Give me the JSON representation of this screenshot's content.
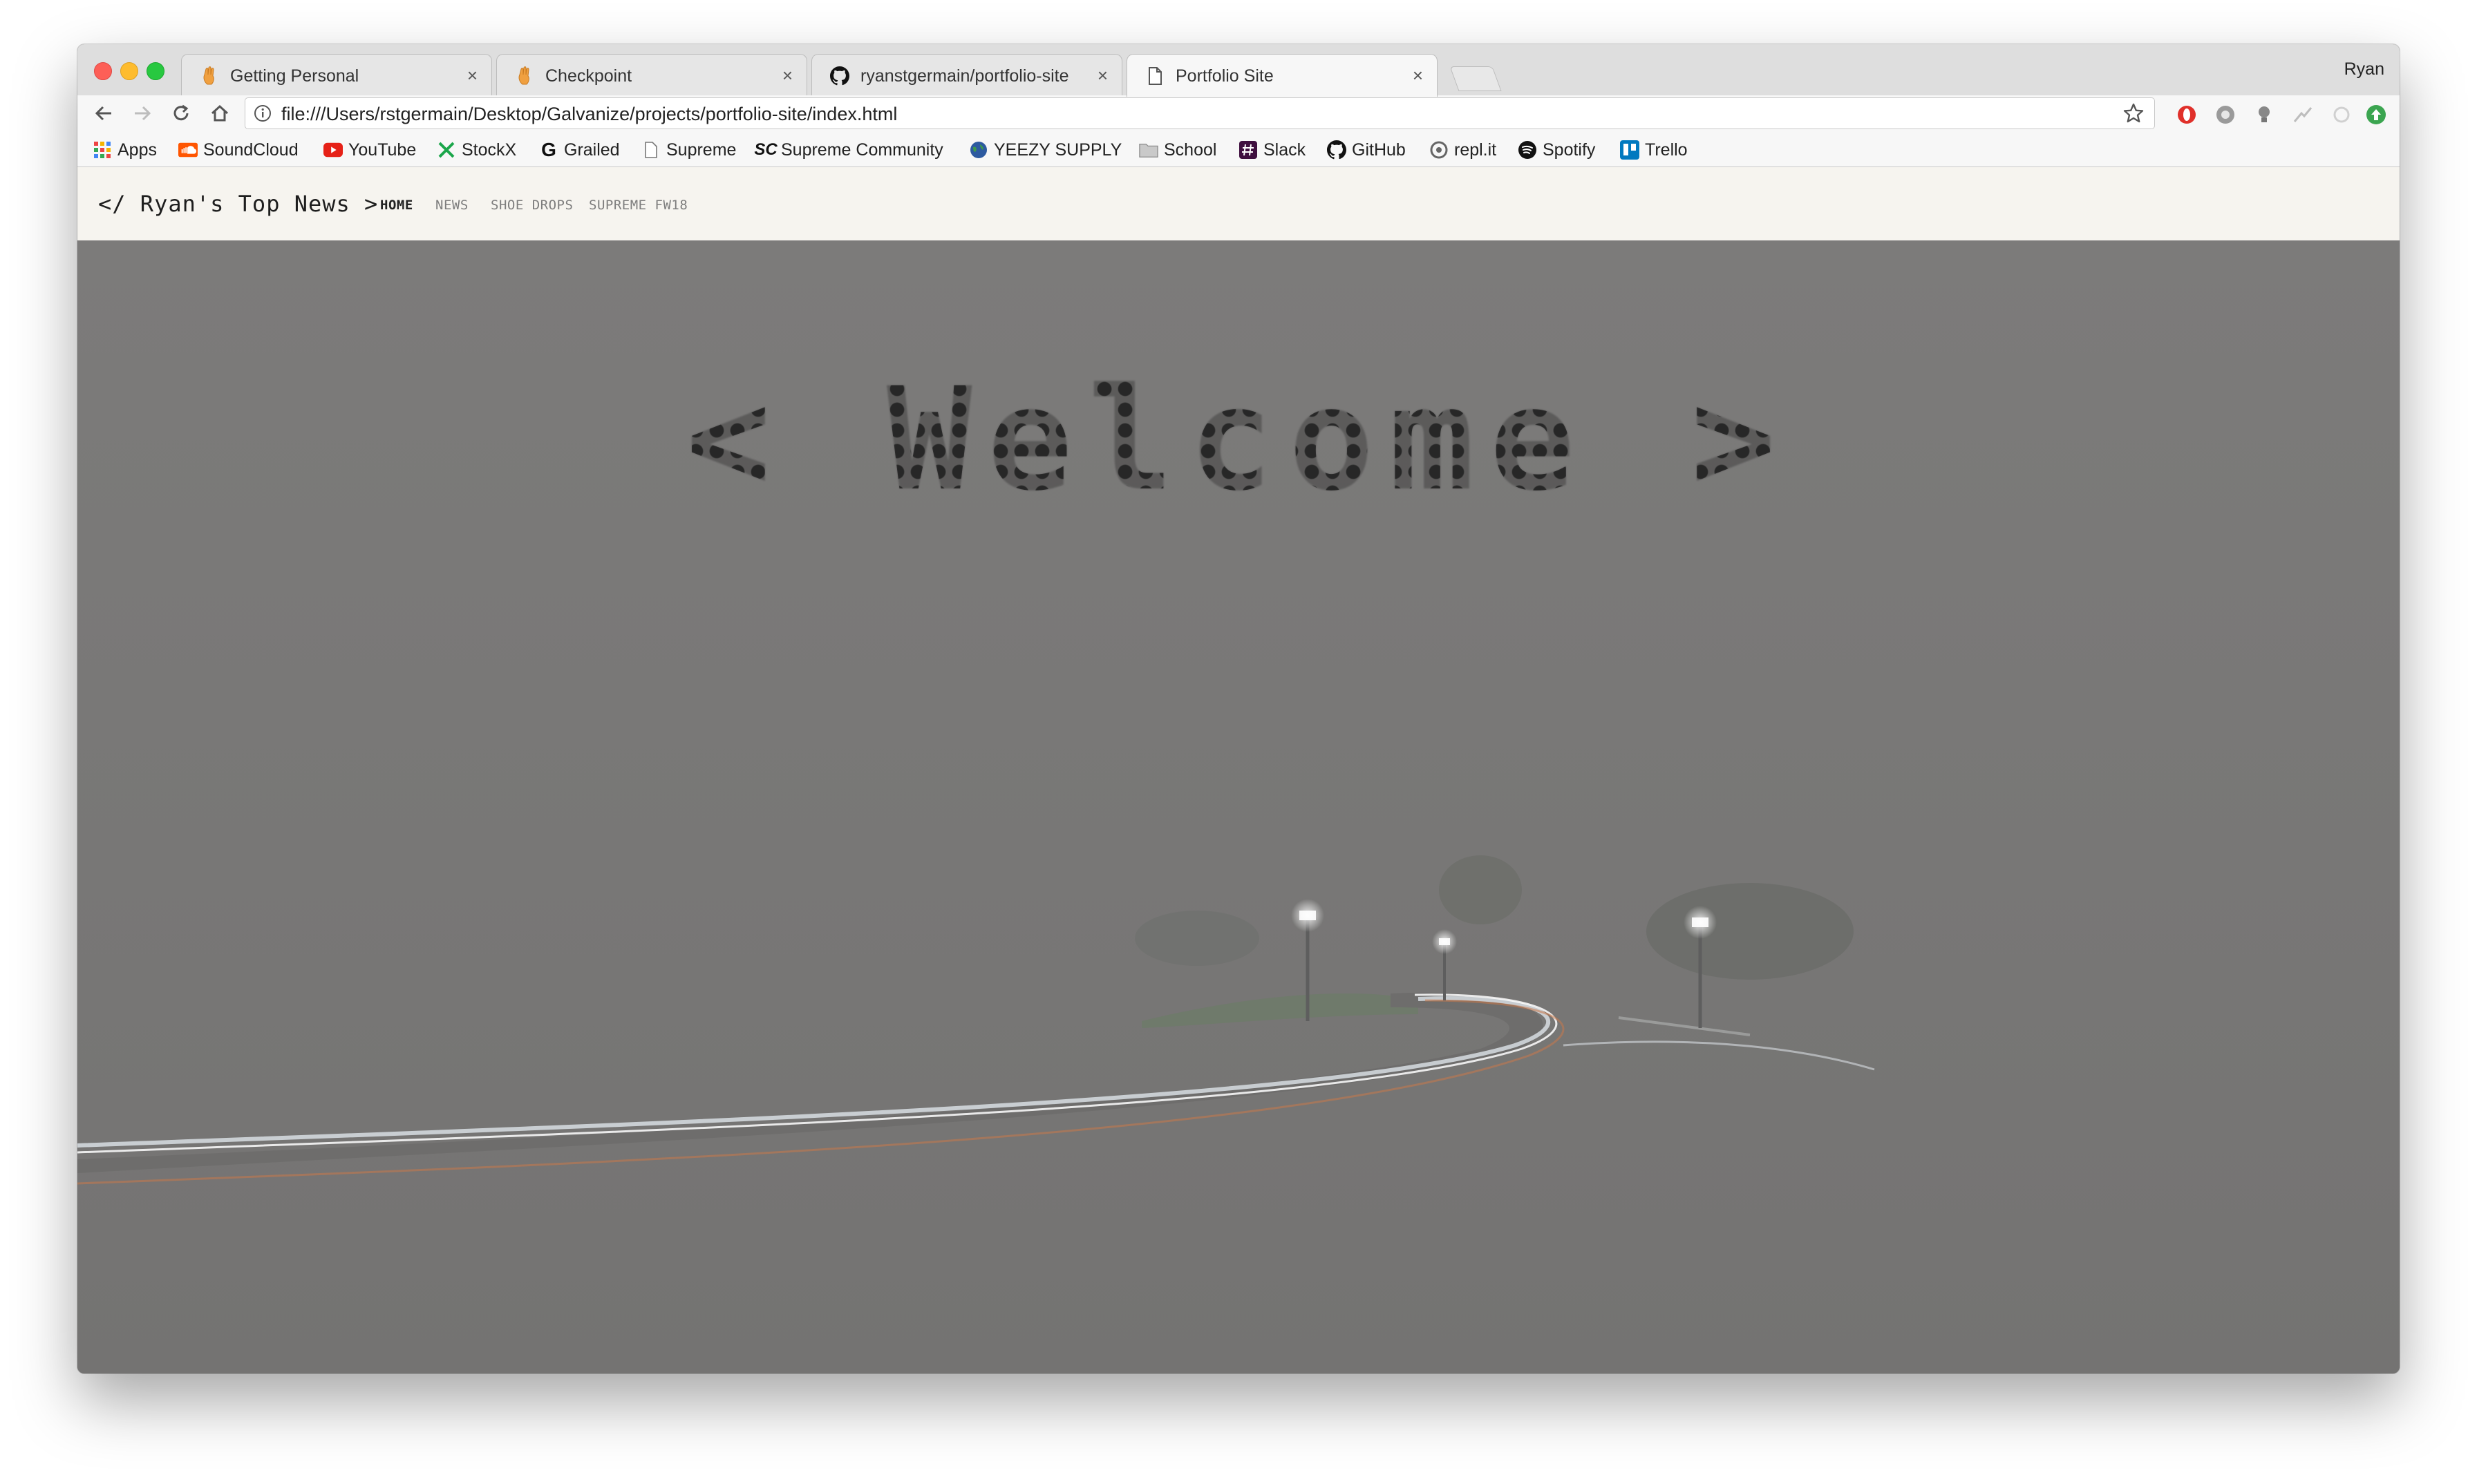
{
  "browser": {
    "profile_name": "Ryan",
    "tabs": [
      {
        "title": "Getting Personal",
        "icon": "hand-icon"
      },
      {
        "title": "Checkpoint",
        "icon": "hand-icon"
      },
      {
        "title": "ryanstgermain/portfolio-site",
        "icon": "github-icon"
      },
      {
        "title": "Portfolio Site",
        "icon": "document-icon",
        "active": true
      }
    ],
    "address_bar": {
      "url": "file:///Users/rstgermain/Desktop/Galvanize/projects/portfolio-site/index.html"
    },
    "bookmarks": [
      {
        "label": "Apps",
        "icon": "apps-grid-icon"
      },
      {
        "label": "SoundCloud",
        "icon": "soundcloud-icon"
      },
      {
        "label": "YouTube",
        "icon": "youtube-icon"
      },
      {
        "label": "StockX",
        "icon": "stockx-icon"
      },
      {
        "label": "Grailed",
        "icon": "grailed-icon"
      },
      {
        "label": "Supreme",
        "icon": "page-icon"
      },
      {
        "label": "Supreme Community",
        "icon": "sc-icon"
      },
      {
        "label": "YEEZY SUPPLY",
        "icon": "globe-icon"
      },
      {
        "label": "School",
        "icon": "folder-icon"
      },
      {
        "label": "Slack",
        "icon": "slack-icon"
      },
      {
        "label": "GitHub",
        "icon": "github-icon"
      },
      {
        "label": "repl.it",
        "icon": "replit-icon"
      },
      {
        "label": "Spotify",
        "icon": "spotify-icon"
      },
      {
        "label": "Trello",
        "icon": "trello-icon"
      }
    ]
  },
  "site": {
    "brand": "</ Ryan's Top News >",
    "nav": [
      {
        "label": "HOME",
        "current": true
      },
      {
        "label": "NEWS"
      },
      {
        "label": "SHOE DROPS"
      },
      {
        "label": "SUPREME FW18"
      }
    ],
    "hero": {
      "left_bracket": "<",
      "heading": "Welcome",
      "right_bracket": ">"
    }
  },
  "colors": {
    "tabstrip_bg": "#dedede",
    "toolbar_bg": "#f7f7f7",
    "site_nav_bg": "#f6f4ef",
    "hero_overlay": "#7a7978",
    "heading_dots": "#343434"
  }
}
